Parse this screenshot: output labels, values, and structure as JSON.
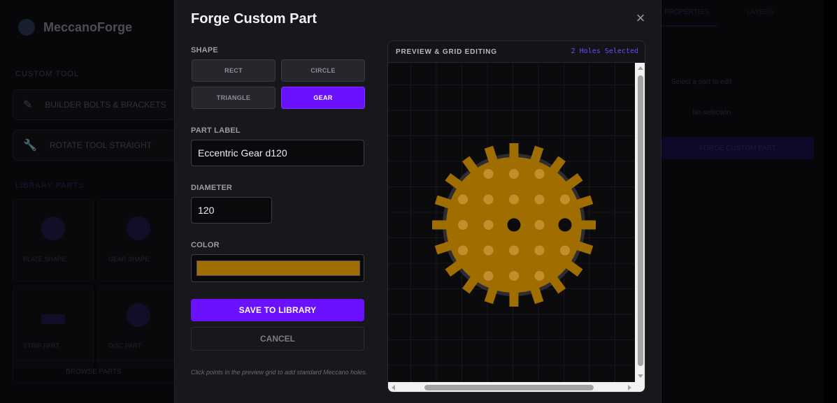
{
  "background": {
    "app_name": "MeccanoForge",
    "section_tools": "CUSTOM TOOL",
    "tools": [
      {
        "label": "BUILDER BOLTS & BRACKETS",
        "icon": "pencil-icon"
      },
      {
        "label": "ROTATE TOOL STRAIGHT",
        "icon": "wrench-icon"
      }
    ],
    "section_library": "LIBRARY PARTS",
    "library_items": [
      "PLATE SHAPE",
      "GEAR SHAPE",
      "STRIP PART",
      "DISC PART"
    ],
    "footer_button": "BROWSE PARTS",
    "right_tabs": [
      "PROPERTIES",
      "LAYERS"
    ],
    "right_texts": [
      "Select a part to edit",
      "No selection"
    ],
    "right_button": "FORGE CUSTOM PART"
  },
  "modal": {
    "title": "Forge Custom Part",
    "close_symbol": "×",
    "shape_label": "SHAPE",
    "shapes": [
      {
        "label": "RECT",
        "active": false
      },
      {
        "label": "CIRCLE",
        "active": false
      },
      {
        "label": "TRIANGLE",
        "active": false
      },
      {
        "label": "GEAR",
        "active": true
      }
    ],
    "part_label_label": "PART LABEL",
    "part_label_value": "Eccentric Gear d120",
    "diameter_label": "DIAMETER",
    "diameter_value": "120",
    "color_label": "COLOR",
    "color_value": "#a06e00",
    "save_label": "SAVE TO LIBRARY",
    "cancel_label": "CANCEL",
    "hint": "Click points in the preview grid to add standard Meccano holes."
  },
  "preview": {
    "title": "PREVIEW & GRID EDITING",
    "status": "2 Holes Selected",
    "gear": {
      "color": "#a06e00",
      "hole_color": "#c18f2c",
      "selected_hole_color": "#0b0b0e",
      "teeth": 20,
      "hole_grid": {
        "rows": [
          -2,
          -1,
          0,
          1,
          2
        ],
        "cols": [
          -2,
          -1,
          0,
          1,
          2
        ],
        "selected": [
          [
            0,
            0
          ],
          [
            0,
            2
          ]
        ]
      }
    }
  }
}
